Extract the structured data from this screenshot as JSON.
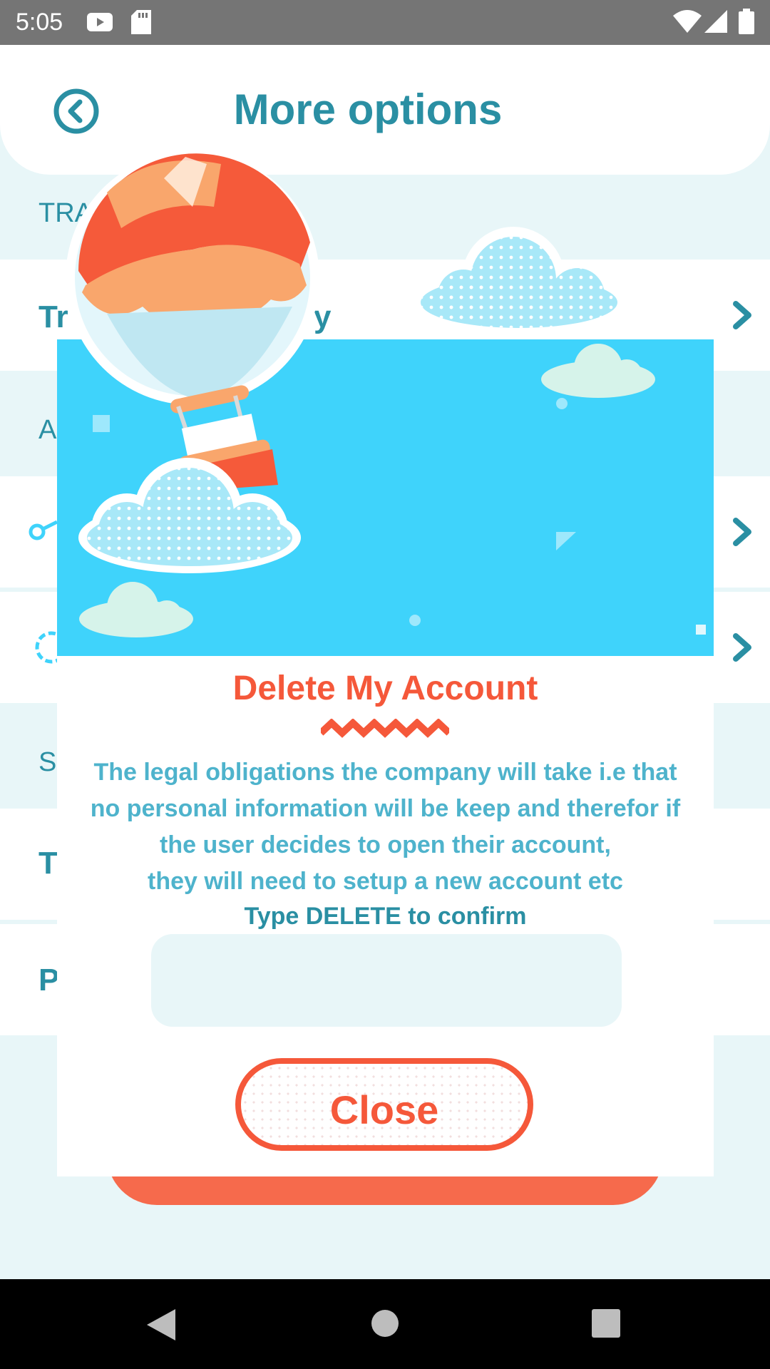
{
  "status_bar": {
    "time": "5:05",
    "left_icons": [
      "youtube-icon",
      "sd-card-icon"
    ],
    "right_icons": [
      "wifi-icon",
      "signal-icon",
      "battery-icon"
    ]
  },
  "header": {
    "title": "More options",
    "back_icon": "chevron-left-circle-icon"
  },
  "background_list": {
    "section_1_label": "TRA",
    "row_1_title_start": "Tr",
    "row_1_title_end": "y",
    "section_2_label": "A",
    "row_share_icon": "share-icon",
    "row_settings_icon": "gear-icon",
    "section_3_label": "S",
    "row_t_title": "T",
    "row_p_title": "P"
  },
  "modal": {
    "title": "Delete My Account",
    "body_lines": [
      "The legal obligations the company will take i.e that",
      "no personal information will be keep and therefor if",
      "the user decides to open their account,",
      "they will need to setup a new account etc"
    ],
    "confirm_prompt": "Type DELETE to confirm",
    "input_value": "",
    "input_placeholder": "",
    "close_label": "Close"
  },
  "colors": {
    "primary": "#2a8fa3",
    "accent": "#f5583a",
    "sky": "#3fd3fb",
    "body_text": "#4eb3cc",
    "background": "#e8f6f8"
  },
  "nav_bar": {
    "icons": [
      "back-triangle-icon",
      "home-circle-icon",
      "recents-square-icon"
    ]
  }
}
